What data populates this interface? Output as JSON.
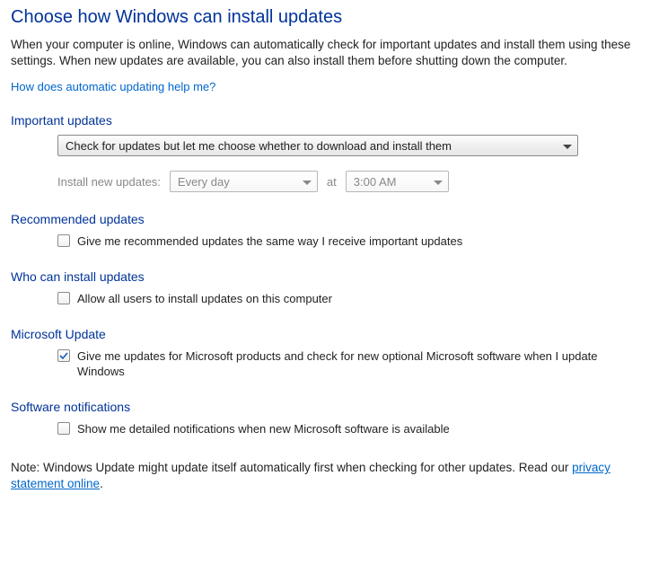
{
  "title": "Choose how Windows can install updates",
  "intro": "When your computer is online, Windows can automatically check for important updates and install them using these settings. When new updates are available, you can also install them before shutting down the computer.",
  "help_link": "How does automatic updating help me?",
  "sections": {
    "important": {
      "title": "Important updates",
      "mode_selected": "Check for updates but let me choose whether to download and install them",
      "schedule_label": "Install new updates:",
      "schedule_freq": "Every day",
      "schedule_at": "at",
      "schedule_time": "3:00 AM"
    },
    "recommended": {
      "title": "Recommended updates",
      "checkbox_label": "Give me recommended updates the same way I receive important updates",
      "checked": false
    },
    "who": {
      "title": "Who can install updates",
      "checkbox_label": "Allow all users to install updates on this computer",
      "checked": false
    },
    "microsoft": {
      "title": "Microsoft Update",
      "checkbox_label": "Give me updates for Microsoft products and check for new optional Microsoft software when I update Windows",
      "checked": true
    },
    "software_notifications": {
      "title": "Software notifications",
      "checkbox_label": "Show me detailed notifications when new Microsoft software is available",
      "checked": false
    }
  },
  "note_prefix": "Note: Windows Update might update itself automatically first when checking for other updates.  Read our ",
  "note_link": "privacy statement online",
  "note_suffix": "."
}
